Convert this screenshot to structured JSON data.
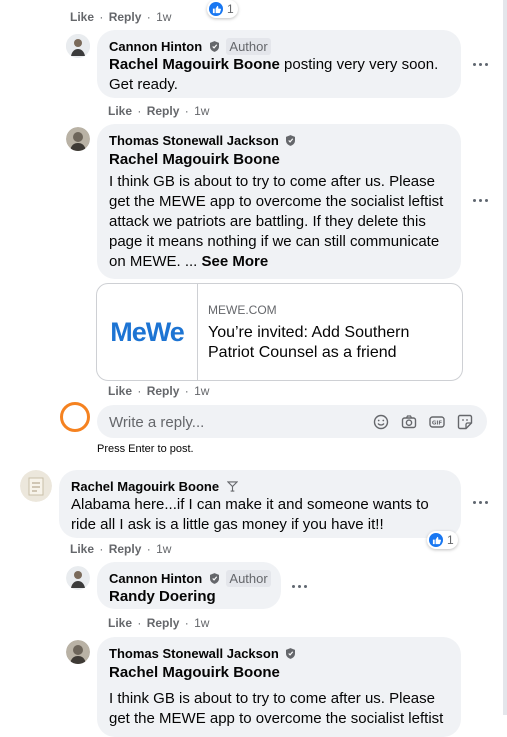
{
  "actions": {
    "like": "Like",
    "reply": "Reply",
    "sep": "·",
    "time": "1w"
  },
  "top_reaction_count": "1",
  "comments": [
    {
      "author": "Cannon Hinton",
      "badge": "Author",
      "mention": "Rachel Magouirk Boone",
      "text_line1": "posting very very soon.",
      "text_line2": "Get ready."
    },
    {
      "author": "Thomas Stonewall Jackson",
      "mention": "Rachel Magouirk Boone",
      "body_lines": [
        "I think GB is about to try to come after us. Please",
        "get the MEWE app to overcome the socialist leftist",
        "attack we patriots are battling. If they delete this",
        "page it means nothing if we can still communicate",
        "on MEWE. ..."
      ],
      "see_more": "See More"
    },
    {
      "author": "Rachel Magouirk Boone",
      "text_line1": "Alabama here...if I can make it and someone wants to",
      "text_line2": "ride all I ask is a little gas money if you have it!!",
      "reaction_count": "1"
    },
    {
      "author": "Cannon Hinton",
      "badge": "Author",
      "mention": "Randy Doering"
    },
    {
      "author": "Thomas Stonewall Jackson",
      "mention": "Rachel Magouirk Boone",
      "body_line1": "I think GB is about to try to come after us. Please",
      "body_line2": "get the MEWE app to overcome the socialist leftist"
    }
  ],
  "link_card": {
    "logo": "MeWe",
    "domain": "MEWE.COM",
    "title_line1": "You’re invited: Add Southern",
    "title_line2": "Patriot Counsel as a friend"
  },
  "reply_box": {
    "placeholder": "Write a reply...",
    "hint": "Press Enter to post."
  },
  "icons": [
    "verified-shield-icon",
    "more-options-icon",
    "like-icon",
    "emoji-icon",
    "camera-icon",
    "gif-icon",
    "sticker-icon"
  ],
  "colors": {
    "accent": "#1877f2",
    "bubble": "#f0f2f5",
    "muted": "#65676b",
    "highlight_ring": "#f58220"
  }
}
